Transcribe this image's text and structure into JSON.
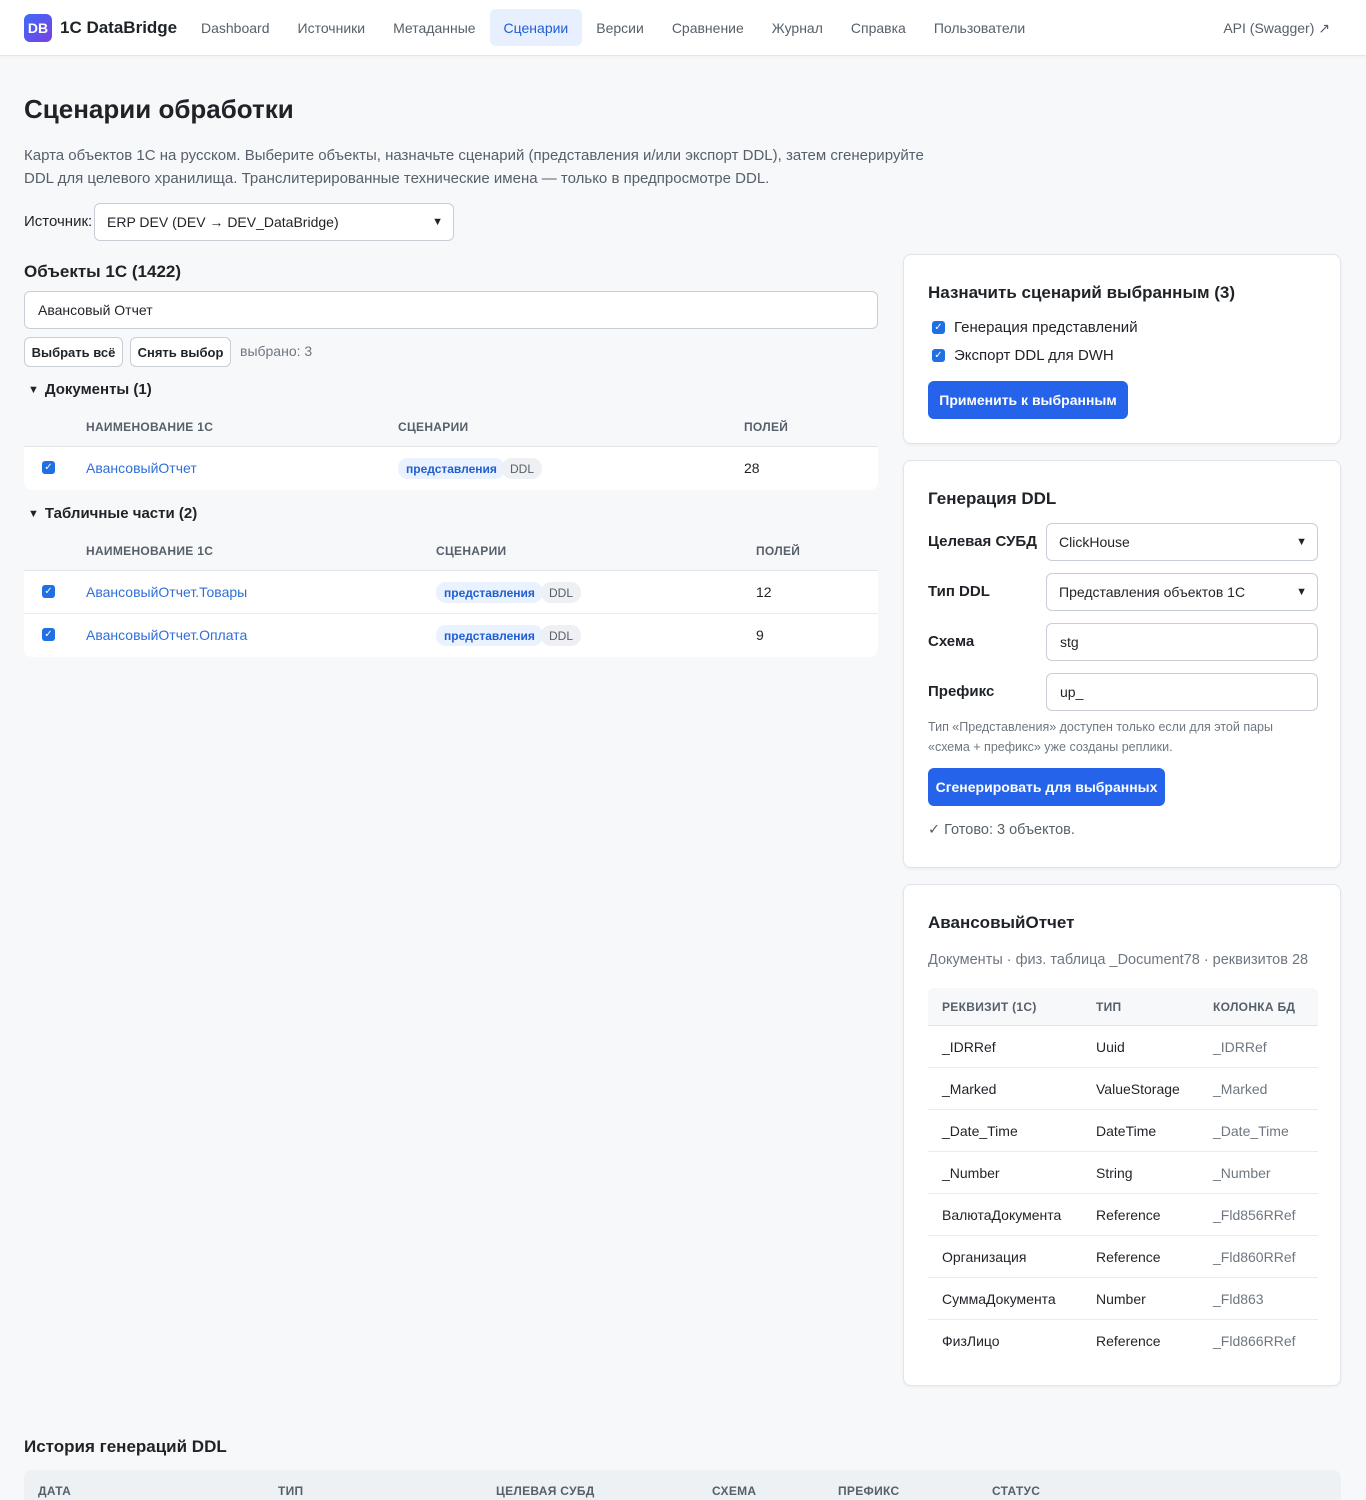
{
  "app": {
    "logo_text": "DB",
    "brand": "1C DataBridge",
    "api_link": "API (Swagger) ↗"
  },
  "nav": {
    "items": [
      {
        "label": "Dashboard",
        "active": false
      },
      {
        "label": "Источники",
        "active": false
      },
      {
        "label": "Метаданные",
        "active": false
      },
      {
        "label": "Сценарии",
        "active": true
      },
      {
        "label": "Версии",
        "active": false
      },
      {
        "label": "Сравнение",
        "active": false
      },
      {
        "label": "Журнал",
        "active": false
      },
      {
        "label": "Справка",
        "active": false
      },
      {
        "label": "Пользователи",
        "active": false
      }
    ]
  },
  "page": {
    "title": "Сценарии обработки",
    "description": "Карта объектов 1С на русском. Выберите объекты, назначьте сценарий (представления и/или экспорт DDL), затем сгенерируйте DDL для целевого хранилища. Транслитерированные технические имена — только в предпросмотре DDL.",
    "source_label": "Источник:",
    "source_value": "ERP DEV (DEV → DEV_DataBridge)"
  },
  "objects": {
    "title": "Объекты 1С (1422)",
    "search_value": "Авансовый Отчет",
    "select_all": "Выбрать всё",
    "clear_selection": "Снять выбор",
    "selected_count": "выбрано: 3",
    "columns": {
      "name": "НАИМЕНОВАНИЕ 1С",
      "scenarios": "СЦЕНАРИИ",
      "fields": "ПОЛЕЙ"
    },
    "groups": [
      {
        "title": "Документы (1)",
        "rows": [
          {
            "name": "АвансовыйОтчет",
            "tag1": "представления",
            "tag2": "DDL",
            "fields": "28",
            "checked": true
          }
        ]
      },
      {
        "title": "Табличные части (2)",
        "rows": [
          {
            "name": "АвансовыйОтчет.Товары",
            "tag1": "представления",
            "tag2": "DDL",
            "fields": "12",
            "checked": true
          },
          {
            "name": "АвансовыйОтчет.Оплата",
            "tag1": "представления",
            "tag2": "DDL",
            "fields": "9",
            "checked": true
          }
        ]
      }
    ]
  },
  "assign": {
    "title": "Назначить сценарий выбранным (3)",
    "opt_views": "Генерация представлений",
    "opt_ddl": "Экспорт DDL для DWH",
    "apply_button": "Применить к выбранным"
  },
  "ddl": {
    "title": "Генерация DDL",
    "dbms_label": "Целевая СУБД",
    "dbms_value": "ClickHouse",
    "type_label": "Тип DDL",
    "type_value": "Представления объектов 1С",
    "schema_label": "Схема",
    "schema_value": "stg",
    "prefix_label": "Префикс",
    "prefix_value": "up_",
    "hint": "Тип «Представления» доступен только если для этой пары «схема + префикс» уже созданы реплики.",
    "generate_button": "Сгенерировать для выбранных",
    "status": "✓ Готово: 3 объектов."
  },
  "details": {
    "title": "АвансовыйОтчет",
    "info": "Документы · физ. таблица _Document78 · реквизитов 28",
    "columns": {
      "attr": "РЕКВИЗИТ (1С)",
      "type": "ТИП",
      "db": "КОЛОНКА БД"
    },
    "rows": [
      {
        "attr": "_IDRRef",
        "type": "Uuid",
        "db": "_IDRRef"
      },
      {
        "attr": "_Marked",
        "type": "ValueStorage",
        "db": "_Marked"
      },
      {
        "attr": "_Date_Time",
        "type": "DateTime",
        "db": "_Date_Time"
      },
      {
        "attr": "_Number",
        "type": "String",
        "db": "_Number"
      },
      {
        "attr": "ВалютаДокумента",
        "type": "Reference",
        "db": "_Fld856RRef"
      },
      {
        "attr": "Организация",
        "type": "Reference",
        "db": "_Fld860RRef"
      },
      {
        "attr": "СуммаДокумента",
        "type": "Number",
        "db": "_Fld863"
      },
      {
        "attr": "ФизЛицо",
        "type": "Reference",
        "db": "_Fld866RRef"
      }
    ]
  },
  "history": {
    "title": "История генераций DDL",
    "columns": {
      "date": "ДАТА",
      "type": "ТИП",
      "dbms": "ЦЕЛЕВАЯ СУБД",
      "schema": "СХЕМА",
      "prefix": "ПРЕФИКС",
      "status": "СТАТУС"
    }
  },
  "colors": {
    "accent": "#2563eb",
    "link": "#2f6fd8",
    "tag_bg": "#eaf1ff"
  }
}
